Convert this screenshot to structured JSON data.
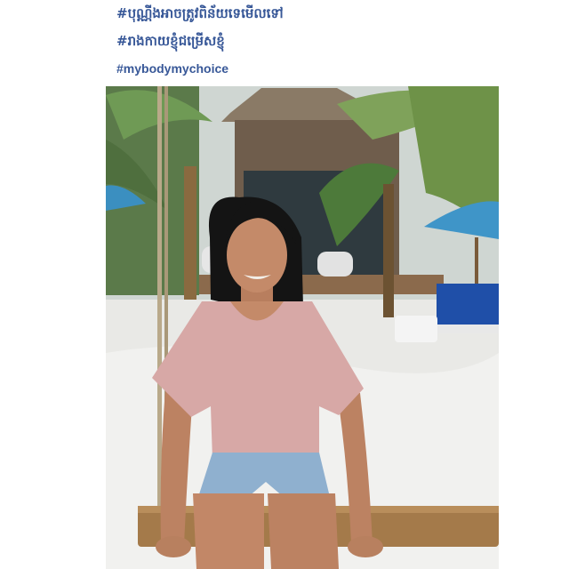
{
  "post": {
    "hashtags": [
      "#បុណ្ណីងអាចត្រូវពិន័យទេមើលទៅ",
      "#រាងកាយខ្ញុំជម្រើសខ្ញុំ",
      "#mybodymychoice"
    ],
    "link_color": "#385898"
  },
  "photo": {
    "subject": "woman in a pink ruffle top and denim shorts smiling on a wooden rope swing at a beach resort",
    "icon": "photo-image"
  }
}
